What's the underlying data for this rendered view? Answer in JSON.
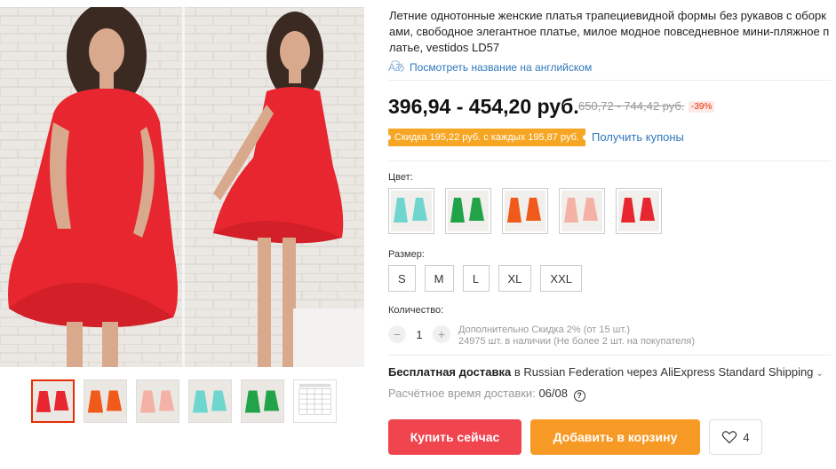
{
  "product": {
    "title": "Летние однотонные женские платья трапециевидной формы без рукавов с оборками, свободное элегантное платье, милое модное повседневное мини-пляжное платье, vestidos LD57",
    "translate_link": "Посмотреть название на английском",
    "translate_icon": "translate-icon"
  },
  "price": {
    "current": "396,94 - 454,20 руб.",
    "original": "650,72 - 744,42 руб.",
    "discount": "-39%"
  },
  "coupon": {
    "badge": "Скидка 195,22 руб. с каждых 195,87 руб.",
    "link": "Получить купоны"
  },
  "color": {
    "label": "Цвет:",
    "options": [
      "aqua",
      "green",
      "orange",
      "pink",
      "red"
    ]
  },
  "size": {
    "label": "Размер:",
    "options": [
      "S",
      "M",
      "L",
      "XL",
      "XXL"
    ]
  },
  "quantity": {
    "label": "Количество:",
    "value": "1",
    "minus": "−",
    "plus": "+",
    "extra_discount": "Дополнительно Скидка 2% (от 15 шт.)",
    "stock": "24975 шт. в наличии (Не более 2 шт. на покупателя)"
  },
  "shipping": {
    "free": "Бесплатная доставка",
    "details": " в Russian Federation через AliExpress Standard Shipping",
    "eta_label": "Расчётное время доставки:",
    "eta_date": "06/08",
    "help": "?"
  },
  "actions": {
    "buy": "Купить сейчас",
    "cart": "Добавить в корзину",
    "wishlist_count": "4"
  },
  "gallery": {
    "thumbnails": [
      "red",
      "orange",
      "pink",
      "aqua",
      "green",
      "size-chart"
    ]
  },
  "colors": {
    "accent_red": "#f0444f",
    "accent_orange": "#f79a25",
    "link_blue": "#2e77bb",
    "coupon_bg": "#f6a623",
    "dress_red": "#e8262f"
  }
}
